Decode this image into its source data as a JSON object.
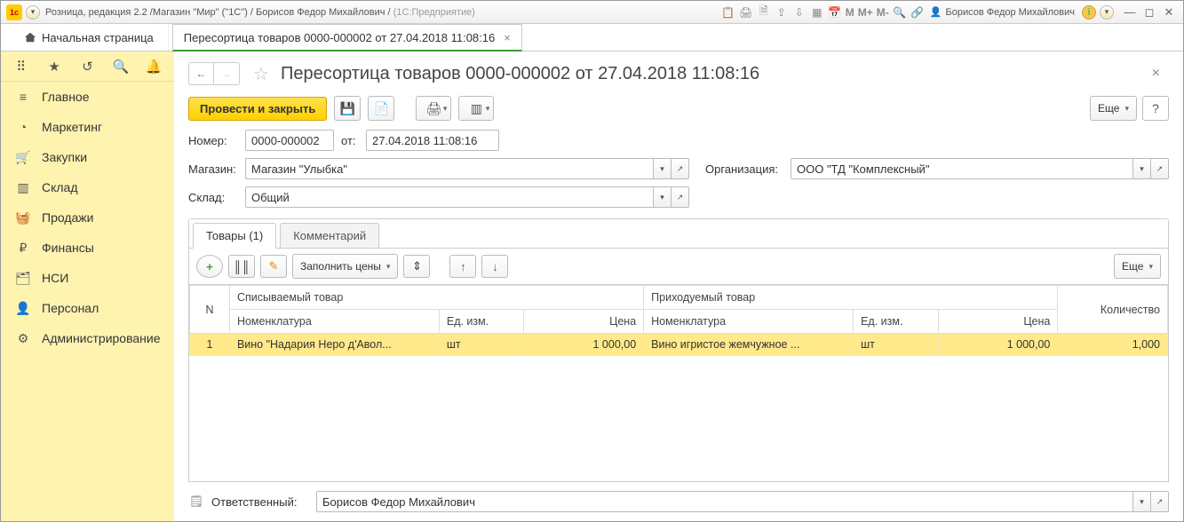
{
  "titlebar": {
    "app_title": "Розница, редакция 2.2 /Магазин \"Мир\" (\"1С\") / Борисов Федор Михайлович /",
    "platform": "(1С:Предприятие)",
    "user_name": "Борисов Федор Михайлович"
  },
  "tabs": {
    "home": "Начальная страница",
    "doc": "Пересортица товаров 0000-000002 от 27.04.2018 11:08:16"
  },
  "sidenav": {
    "items": [
      {
        "label": "Главное"
      },
      {
        "label": "Маркетинг"
      },
      {
        "label": "Закупки"
      },
      {
        "label": "Склад"
      },
      {
        "label": "Продажи"
      },
      {
        "label": "Финансы"
      },
      {
        "label": "НСИ"
      },
      {
        "label": "Персонал"
      },
      {
        "label": "Администрирование"
      }
    ]
  },
  "doc": {
    "title": "Пересортица товаров 0000-000002 от 27.04.2018 11:08:16",
    "post_and_close": "Провести и закрыть",
    "more": "Еще",
    "number_label": "Номер:",
    "number_value": "0000-000002",
    "from_label": "от:",
    "date_value": "27.04.2018 11:08:16",
    "store_label": "Магазин:",
    "store_value": "Магазин \"Улыбка\"",
    "org_label": "Организация:",
    "org_value": "ООО \"ТД \"Комплексный\"",
    "warehouse_label": "Склад:",
    "warehouse_value": "Общий",
    "tab_goods": "Товары (1)",
    "tab_comment": "Комментарий",
    "fill_prices": "Заполнить цены"
  },
  "grid": {
    "headers": {
      "n": "N",
      "out_good": "Списываемый товар",
      "in_good": "Приходуемый товар",
      "qty": "Количество",
      "nomen": "Номенклатура",
      "unit": "Ед. изм.",
      "price": "Цена"
    },
    "rows": [
      {
        "n": "1",
        "out_nomen": "Вино \"Надария Неро д'Авол...",
        "out_unit": "шт",
        "out_price": "1 000,00",
        "in_nomen": "Вино игристое жемчужное ...",
        "in_unit": "шт",
        "in_price": "1 000,00",
        "qty": "1,000"
      }
    ]
  },
  "footer": {
    "resp_label": "Ответственный:",
    "resp_value": "Борисов Федор Михайлович"
  }
}
